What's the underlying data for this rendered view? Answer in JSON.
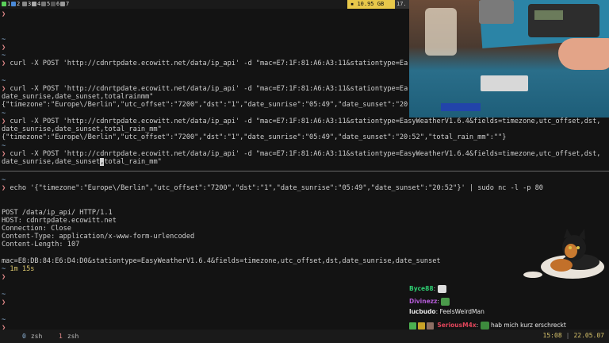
{
  "topbar": {
    "workspaces": [
      "1",
      "2",
      "3",
      "4",
      "5",
      "6",
      "7"
    ],
    "disk": "10.95 GB",
    "disk_extra": "17."
  },
  "terminal": {
    "prompt_symbol": "❯",
    "tilde": "~",
    "cmd1": "curl -X POST 'http://cdnrtpdate.ecowitt.net/data/ip_api' -d \"mac=E7:1F:81:A6:A3:11&stationtype=Ea",
    "cmd2a": "curl -X POST 'http://cdnrtpdate.ecowitt.net/data/ip_api' -d \"mac=E7:1F:81:A6:A3:11&stationtype=Ea",
    "cmd2b": "date_sunrise,date_sunset,totalrainmm\"",
    "out2": "{\"timezone\":\"Europe\\/Berlin\",\"utc_offset\":\"7200\",\"dst\":\"1\",\"date_sunrise\":\"05:49\",\"date_sunset\":\"20",
    "cmd3a": "curl -X POST 'http://cdnrtpdate.ecowitt.net/data/ip_api' -d \"mac=E7:1F:81:A6:A3:11&stationtype=EasyWeatherV1.6.4&fields=timezone,utc_offset,dst,",
    "cmd3b": "date_sunrise,date_sunset,total_rain_mm\"",
    "out3": "{\"timezone\":\"Europe\\/Berlin\",\"utc_offset\":\"7200\",\"dst\":\"1\",\"date_sunrise\":\"05:49\",\"date_sunset\":\"20:52\",\"total_rain_mm\":\"\"}",
    "cmd4a": "curl -X POST 'http://cdnrtpdate.ecowitt.net/data/ip_api' -d \"mac=E7:1F:81:A6:A3:11&stationtype=EasyWeatherV1.6.4&fields=timezone,utc_offset,dst,",
    "cmd4b_pre": "date_sunrise,date_sunset",
    "cmd4b_cursor": ",",
    "cmd4b_post": "total_rain_mm\"",
    "pane2_cmd": "echo '{\"timezone\":\"Europe\\/Berlin\",\"utc_offset\":\"7200\",\"dst\":\"1\",\"date_sunrise\":\"05:49\",\"date_sunset\":\"20:52\"}' | sudo nc -l -p 80",
    "http_lines": [
      "POST /data/ip_api/ HTTP/1.1",
      "HOST: cdnrtpdate.ecowitt.net",
      "Connection: Close",
      "Content-Type: application/x-www-form-urlencoded",
      "Content-Length: 107"
    ],
    "body_line": "mac=E8:DB:84:E6:D4:D0&stationtype=EasyWeatherV1.6.4&fields=timezone,utc_offset,dst,date_sunrise,date_sunset",
    "duration": "1m 15s"
  },
  "chat": [
    {
      "user": "Byce88",
      "text": "",
      "color": "#2ecc71"
    },
    {
      "user": "Divinezz",
      "text": "",
      "color": "#b45bd6"
    },
    {
      "user": "lucbudo",
      "text": "FeelsWeirdMan",
      "color": "#e8e8e8"
    },
    {
      "user": "SeriousM4x",
      "text": "hab mich kurz erschreckt",
      "color": "#e0455a"
    }
  ],
  "bottombar": {
    "tabs": [
      {
        "num": "0",
        "name": "zsh"
      },
      {
        "num": "1",
        "name": "zsh"
      }
    ],
    "time": "15:08",
    "date": "22.05.07"
  },
  "colors": {
    "background": "#131313",
    "prompt": "#e58b8b",
    "accent_yellow": "#d7c36b",
    "disk_bg": "#e8c84a"
  }
}
